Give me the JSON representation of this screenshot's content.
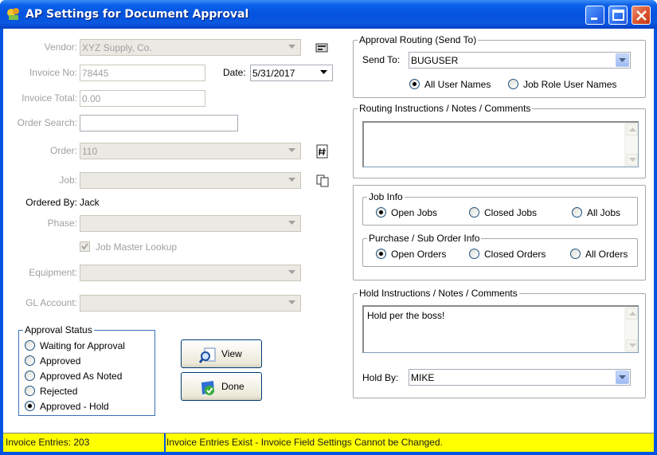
{
  "window": {
    "title": "AP Settings for Document Approval"
  },
  "form": {
    "vendor_label": "Vendor:",
    "vendor_value": "XYZ Supply, Co.",
    "invoice_no_label": "Invoice No:",
    "invoice_no_value": "78445",
    "date_label": "Date:",
    "date_value": "5/31/2017",
    "invoice_total_label": "Invoice Total:",
    "invoice_total_value": "0.00",
    "order_search_label": "Order Search:",
    "order_search_value": "",
    "order_label": "Order:",
    "order_value": "110",
    "job_label": "Job:",
    "job_value": "",
    "ordered_by_label": "Ordered By:",
    "ordered_by_value": "Jack",
    "phase_label": "Phase:",
    "phase_value": "",
    "job_master_lookup_label": "Job Master Lookup",
    "job_master_lookup_checked": true,
    "equipment_label": "Equipment:",
    "equipment_value": "",
    "gl_account_label": "GL Account:",
    "gl_account_value": ""
  },
  "approval_status": {
    "title": "Approval Status",
    "options": [
      "Waiting for Approval",
      "Approved",
      "Approved As Noted",
      "Rejected",
      "Approved - Hold"
    ],
    "selected": "Approved - Hold"
  },
  "buttons": {
    "view_label": "View",
    "done_label": "Done"
  },
  "routing": {
    "title": "Approval Routing (Send To)",
    "send_to_label": "Send To:",
    "send_to_value": "BUGUSER",
    "all_user_names": "All User Names",
    "job_role_user_names": "Job Role User Names",
    "selected": "All User Names"
  },
  "routing_notes": {
    "title": "Routing Instructions / Notes / Comments",
    "text": ""
  },
  "job_info": {
    "title": "Job Info",
    "open": "Open Jobs",
    "closed": "Closed Jobs",
    "all": "All Jobs",
    "selected": "Open Jobs"
  },
  "po_info": {
    "title": "Purchase / Sub Order Info",
    "open": "Open Orders",
    "closed": "Closed Orders",
    "all": "All Orders",
    "selected": "Open Orders"
  },
  "hold": {
    "title": "Hold Instructions / Notes / Comments",
    "text": "Hold per the boss!",
    "hold_by_label": "Hold By:",
    "hold_by_value": "MIKE"
  },
  "status_bar": {
    "left": "Invoice Entries: 203",
    "right": "Invoice Entries Exist - Invoice Field Settings Cannot be Changed."
  },
  "colors": {
    "status_bg": "#ffff00",
    "titlebar": "#0453df",
    "group_accent": "#3b6fb8"
  }
}
